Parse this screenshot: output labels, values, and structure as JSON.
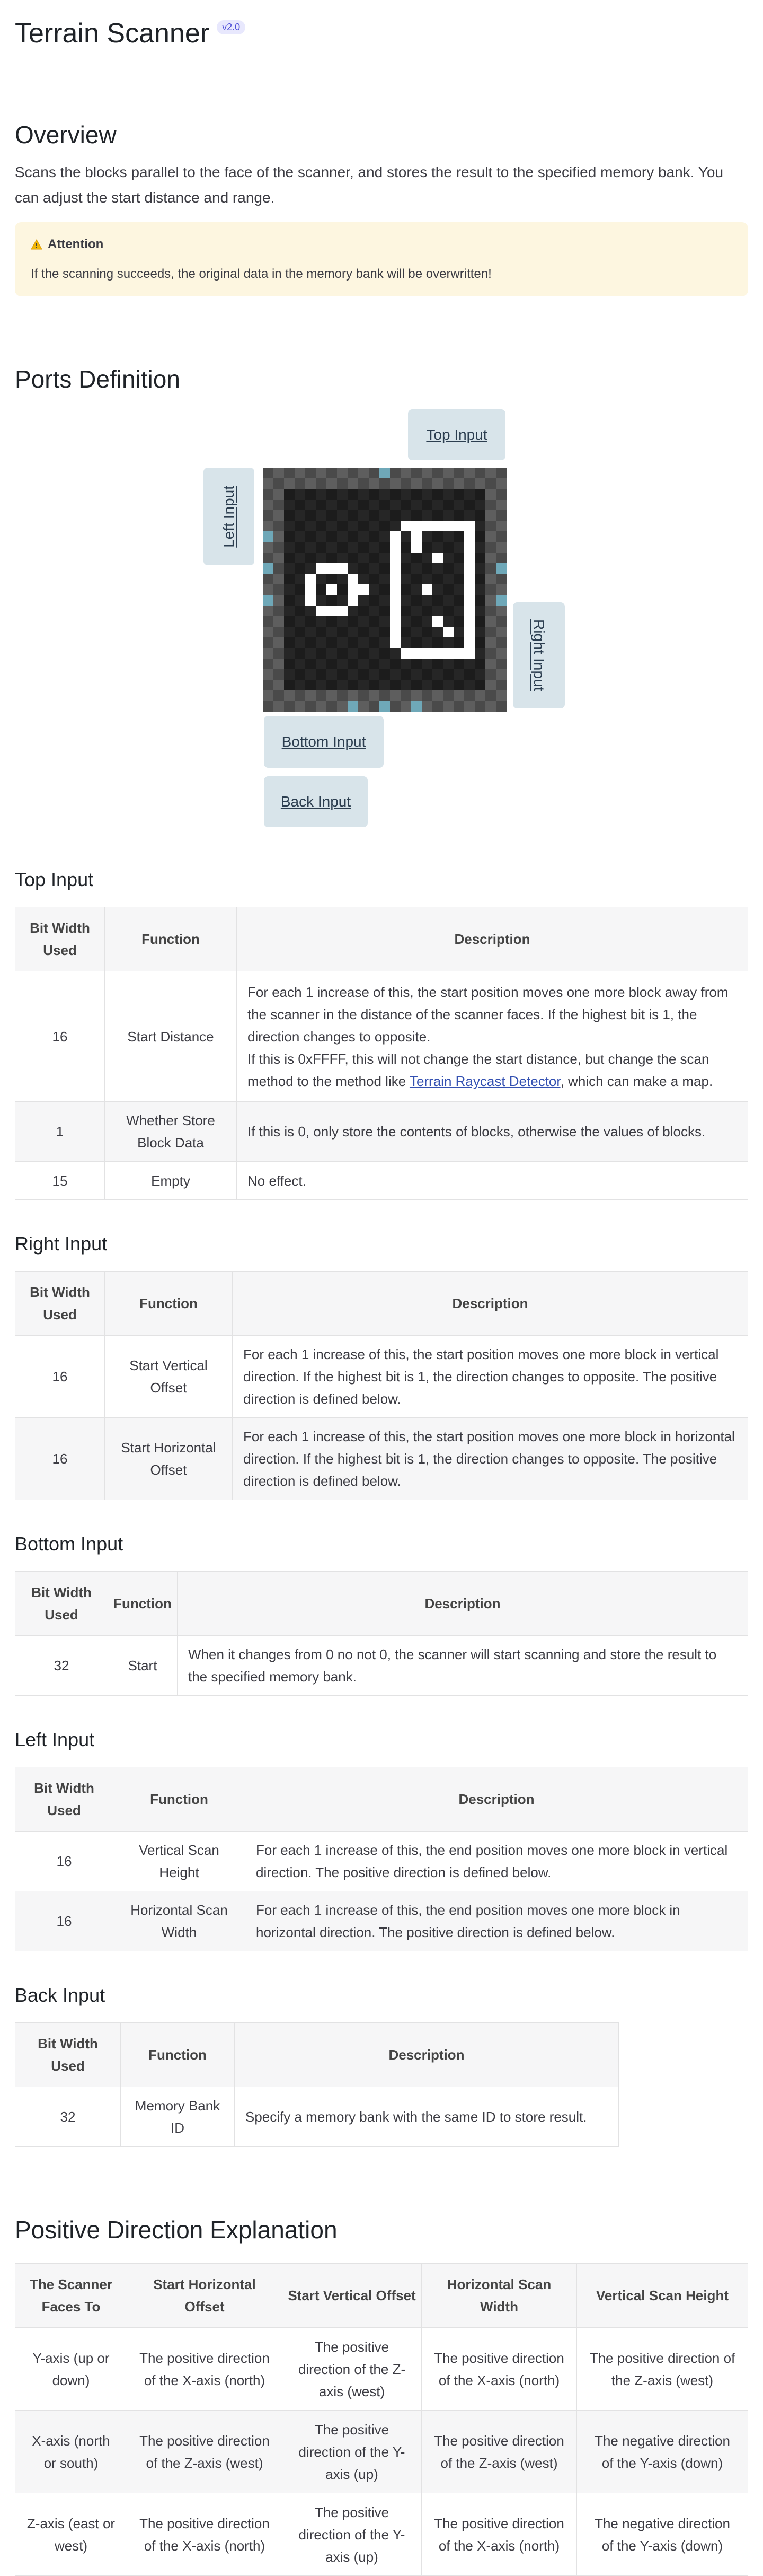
{
  "header": {
    "title": "Terrain Scanner",
    "version": "v2.0"
  },
  "overview": {
    "heading": "Overview",
    "text": "Scans the blocks parallel to the face of the scanner, and stores the result to the specified memory bank. You can adjust the start distance and range.",
    "attention_title": "Attention",
    "attention_text": "If the scanning succeeds, the original data in the memory bank will be overwritten!"
  },
  "ports": {
    "heading": "Ports Definition",
    "top": "Top Input",
    "left": "Left Input",
    "right": "Right Input",
    "bottom": "Bottom Input",
    "back": "Back Input"
  },
  "top_input": {
    "heading": "Top Input",
    "headers": [
      "Bit Width Used",
      "Function",
      "Description"
    ],
    "rows": [
      {
        "bits": "16",
        "function": "Start Distance",
        "desc1": "For each 1 increase of this, the start position moves one more block away from the scanner in the distance of the scanner faces. If the highest bit is 1, the direction changes to opposite.",
        "desc2_pre": "If this is 0xFFFF, this will not change the start distance, but change the scan method to the method like ",
        "desc2_link": "Terrain Raycast Detector",
        "desc2_post": ", which can make a map."
      },
      {
        "bits": "1",
        "function": "Whether Store Block Data",
        "desc": "If this is 0, only store the contents of blocks, otherwise the values of blocks."
      },
      {
        "bits": "15",
        "function": "Empty",
        "desc": "No effect."
      }
    ]
  },
  "right_input": {
    "heading": "Right Input",
    "headers": [
      "Bit Width Used",
      "Function",
      "Description"
    ],
    "rows": [
      {
        "bits": "16",
        "function": "Start Vertical Offset",
        "desc": "For each 1 increase of this, the start position moves one more block in vertical direction. If the highest bit is 1, the direction changes to opposite. The positive direction is defined below."
      },
      {
        "bits": "16",
        "function": "Start Horizontal Offset",
        "desc": "For each 1 increase of this, the start position moves one more block in horizontal direction. If the highest bit is 1, the direction changes to opposite. The positive direction is defined below."
      }
    ]
  },
  "bottom_input": {
    "heading": "Bottom Input",
    "headers": [
      "Bit Width Used",
      "Function",
      "Description"
    ],
    "rows": [
      {
        "bits": "32",
        "function": "Start",
        "desc": "When it changes from 0 no not 0, the scanner will start scanning and store the result to the specified memory bank."
      }
    ]
  },
  "left_input": {
    "heading": "Left Input",
    "headers": [
      "Bit Width Used",
      "Function",
      "Description"
    ],
    "rows": [
      {
        "bits": "16",
        "function": "Vertical Scan Height",
        "desc": "For each 1 increase of this, the end position moves one more block in vertical direction. The positive direction is defined below."
      },
      {
        "bits": "16",
        "function": "Horizontal Scan Width",
        "desc": "For each 1 increase of this, the end position moves one more block in horizontal direction. The positive direction is defined below."
      }
    ]
  },
  "back_input": {
    "heading": "Back Input",
    "headers": [
      "Bit Width Used",
      "Function",
      "Description"
    ],
    "rows": [
      {
        "bits": "32",
        "function": "Memory Bank ID",
        "desc": "Specify a memory bank with the same ID to store result."
      }
    ]
  },
  "positive": {
    "heading": "Positive Direction Explanation",
    "headers": [
      "The Scanner Faces To",
      "Start Horizontal Offset",
      "Start Vertical Offset",
      "Horizontal Scan Width",
      "Vertical Scan Height"
    ],
    "rows": [
      [
        "Y-axis (up or down)",
        "The positive direction of the X-axis (north)",
        "The positive direction of the Z-axis (west)",
        "The positive direction of the X-axis (north)",
        "The positive direction of the Z-axis (west)"
      ],
      [
        "X-axis (north or south)",
        "The positive direction of the Z-axis (west)",
        "The positive direction of the Y-axis (up)",
        "The positive direction of the Z-axis (west)",
        "The negative direction of the Y-axis (down)"
      ],
      [
        "Z-axis (east or west)",
        "The positive direction of the X-axis (north)",
        "The positive direction of the Y-axis (up)",
        "The positive direction of the X-axis (north)",
        "The negative direction of the Y-axis (down)"
      ]
    ]
  },
  "colors": {
    "port_bg": "#d8e4ea",
    "warning_bg": "#fdf6e0",
    "link": "#3451b2",
    "badge": "#4d4dd8",
    "pixel_accent": "#6fa8b8"
  }
}
